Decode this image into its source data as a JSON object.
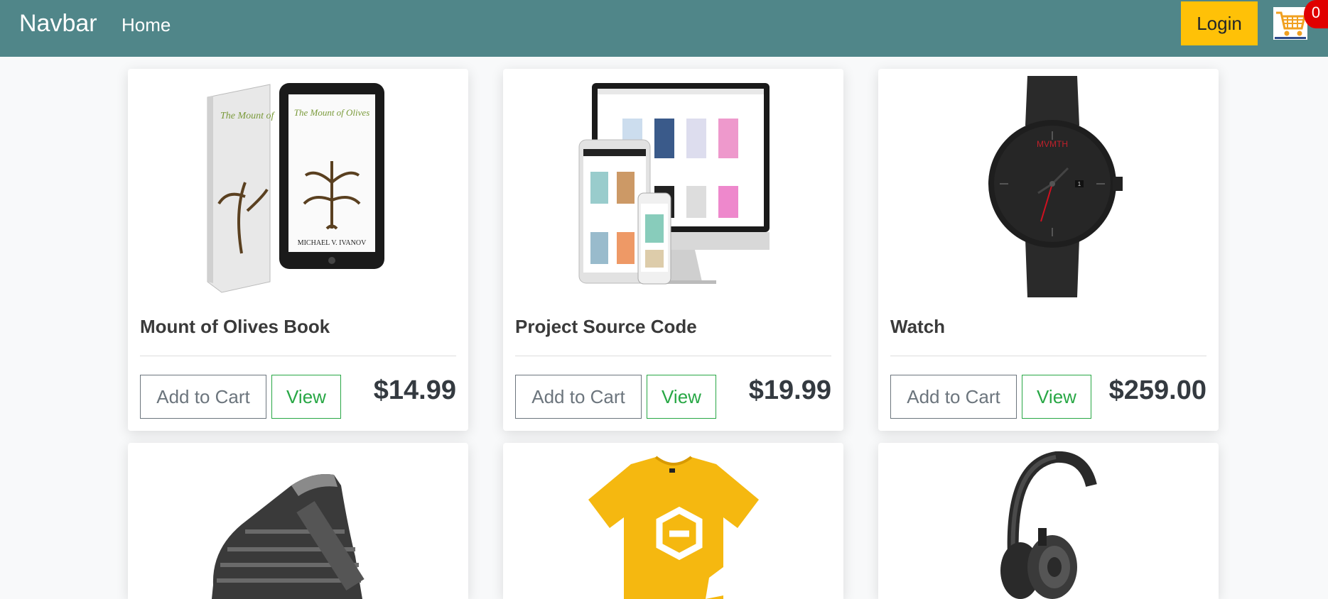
{
  "navbar": {
    "brand": "Navbar",
    "home_link": "Home",
    "login_label": "Login",
    "cart_count": "0",
    "accent_color": "#508689",
    "cart_icon": "shopping-cart-icon"
  },
  "products": [
    {
      "title": "Mount of Olives Book",
      "add_to_cart_label": "Add to Cart",
      "view_label": "View",
      "price": "$14.99",
      "image": "book-and-tablet-image"
    },
    {
      "title": "Project Source Code",
      "add_to_cart_label": "Add to Cart",
      "view_label": "View",
      "price": "$19.99",
      "image": "responsive-devices-image"
    },
    {
      "title": "Watch",
      "add_to_cart_label": "Add to Cart",
      "view_label": "View",
      "price": "$259.00",
      "image": "black-watch-image"
    },
    {
      "image": "sneaker-image"
    },
    {
      "image": "yellow-tshirt-image"
    },
    {
      "image": "headphones-image"
    }
  ]
}
